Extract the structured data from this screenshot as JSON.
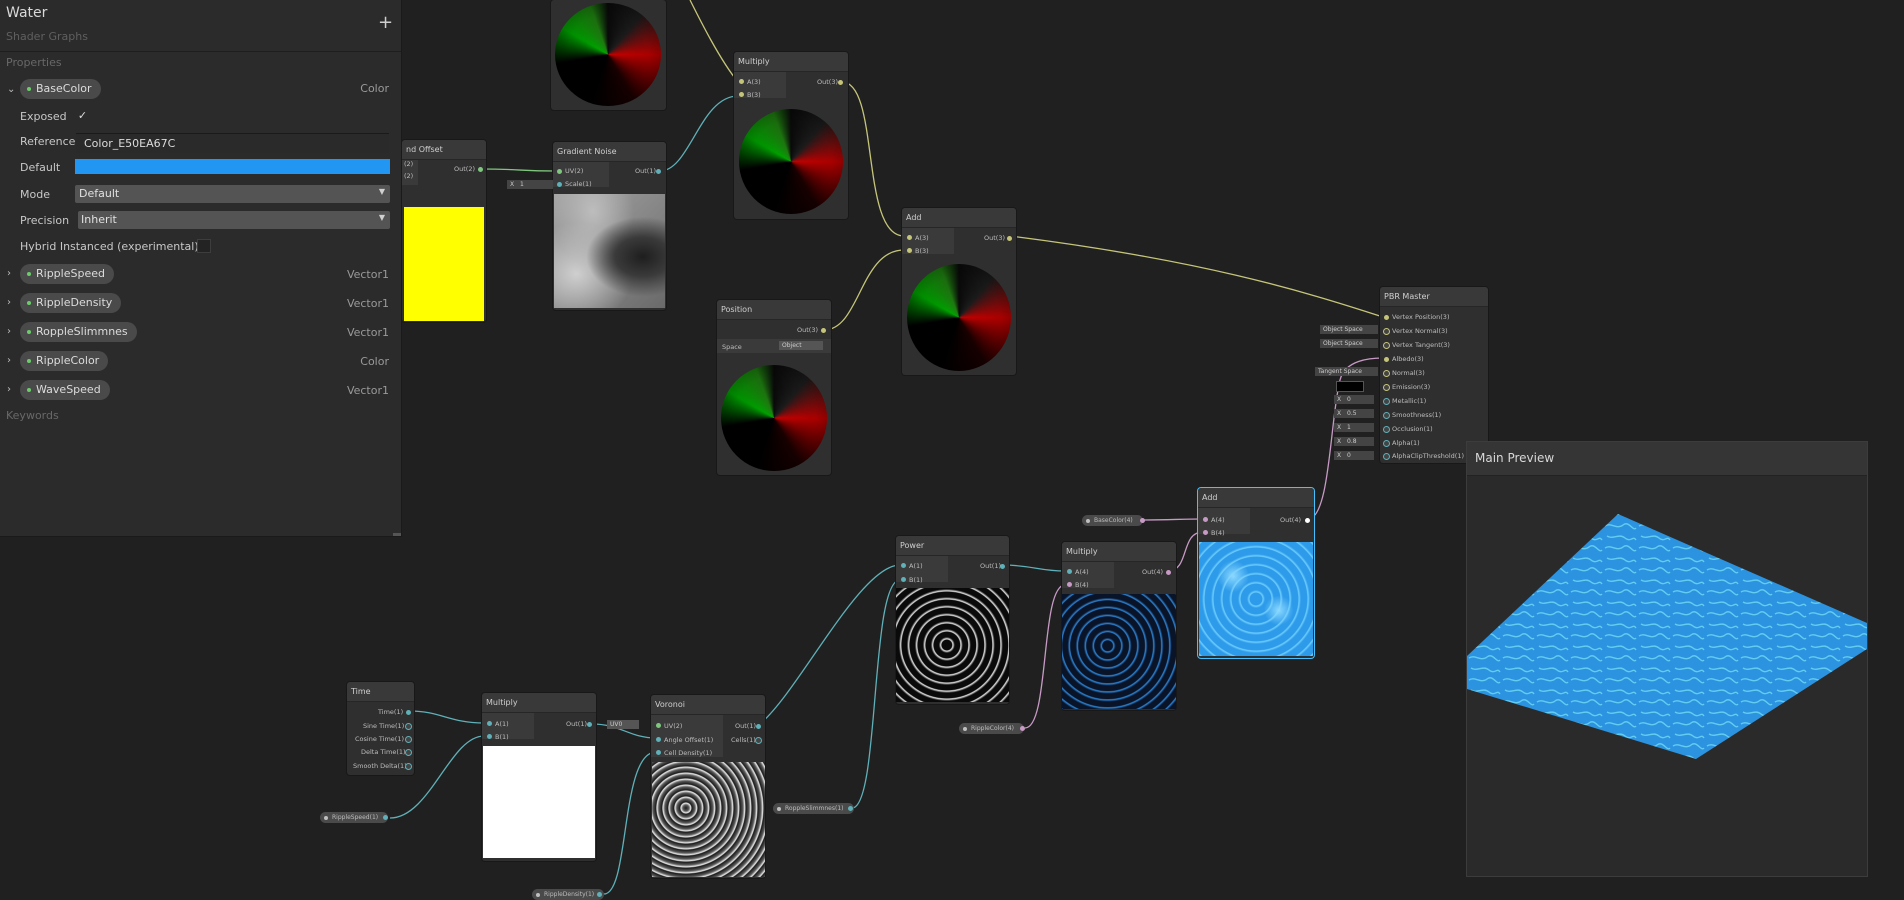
{
  "blackboard": {
    "title": "Water",
    "subtitle": "Shader Graphs",
    "add_symbol": "+",
    "properties_header": "Properties",
    "keywords_header": "Keywords",
    "expanded": {
      "name": "BaseColor",
      "type": "Color",
      "exposed_label": "Exposed",
      "exposed_check": "✓",
      "reference_label": "Reference",
      "reference_value": "Color_E50EA67C",
      "default_label": "Default",
      "default_color": "#2196f3",
      "mode_label": "Mode",
      "mode_value": "Default",
      "precision_label": "Precision",
      "precision_value": "Inherit",
      "hybrid_label": "Hybrid Instanced (experimental)"
    },
    "properties": [
      {
        "name": "RippleSpeed",
        "type": "Vector1"
      },
      {
        "name": "RippleDensity",
        "type": "Vector1"
      },
      {
        "name": "RoppleSlimmnes",
        "type": "Vector1"
      },
      {
        "name": "RippleColor",
        "type": "Color"
      },
      {
        "name": "WaveSpeed",
        "type": "Vector1"
      }
    ]
  },
  "nodes": {
    "tiling_offset": {
      "title": "nd Offset",
      "out": "Out(2)",
      "in1": "(2)",
      "in2": "(2)"
    },
    "gradient_noise": {
      "title": "Gradient Noise",
      "in1": "UV(2)",
      "in2": "Scale(1)",
      "out": "Out(1)",
      "x_label": "X",
      "x_value": "1"
    },
    "multiply_top": {
      "title": "Multiply",
      "in1": "A(3)",
      "in2": "B(3)",
      "out": "Out(3)"
    },
    "add_mid": {
      "title": "Add",
      "in1": "A(3)",
      "in2": "B(3)",
      "out": "Out(3)"
    },
    "position": {
      "title": "Position",
      "out": "Out(3)",
      "space_label": "Space",
      "space_value": "Object"
    },
    "pbr_master": {
      "title": "PBR Master",
      "ports": [
        "Vertex Position(3)",
        "Vertex Normal(3)",
        "Vertex Tangent(3)",
        "Albedo(3)",
        "Normal(3)",
        "Emission(3)",
        "Metallic(1)",
        "Smoothness(1)",
        "Occlusion(1)",
        "Alpha(1)",
        "AlphaClipThreshold(1)"
      ],
      "obj_space_1": "Object Space",
      "obj_space_2": "Object Space",
      "tangent_space": "Tangent Space",
      "values": [
        "0",
        "0.5",
        "1",
        "0.8",
        "0"
      ],
      "x_label": "X"
    },
    "add_bottom": {
      "title": "Add",
      "in1": "A(4)",
      "in2": "B(4)",
      "out": "Out(4)"
    },
    "multiply_bottom": {
      "title": "Multiply",
      "in1": "A(4)",
      "in2": "B(4)",
      "out": "Out(4)"
    },
    "power": {
      "title": "Power",
      "in1": "A(1)",
      "in2": "B(1)",
      "out": "Out(1)"
    },
    "time": {
      "title": "Time",
      "ports": [
        "Time(1)",
        "Sine Time(1)",
        "Cosine Time(1)",
        "Delta Time(1)",
        "Smooth Delta(1)"
      ]
    },
    "multiply_low": {
      "title": "Multiply",
      "in1": "A(1)",
      "in2": "B(1)",
      "out": "Out(1)"
    },
    "voronoi": {
      "title": "Voronoi",
      "in1": "UV(2)",
      "in2": "Angle Offset(1)",
      "in3": "Cell Density(1)",
      "out1": "Out(1)",
      "out2": "Cells(1)",
      "uv_value": "UV0"
    }
  },
  "pills": {
    "base_color": "BaseColor(4)",
    "ripple_color": "RippleColor(4)",
    "ripple_slimmnes": "RoppleSlimmnes(1)",
    "ripple_speed": "RippleSpeed(1)",
    "ripple_density": "RippleDensity(1)"
  },
  "preview": {
    "title": "Main Preview"
  },
  "colors": {
    "water": "#2a9ce0",
    "yellow": "#ffff00",
    "wire_vec3": "#c5c57a",
    "wire_vec1": "#5fb0b8",
    "wire_color": "#c79ac5"
  }
}
